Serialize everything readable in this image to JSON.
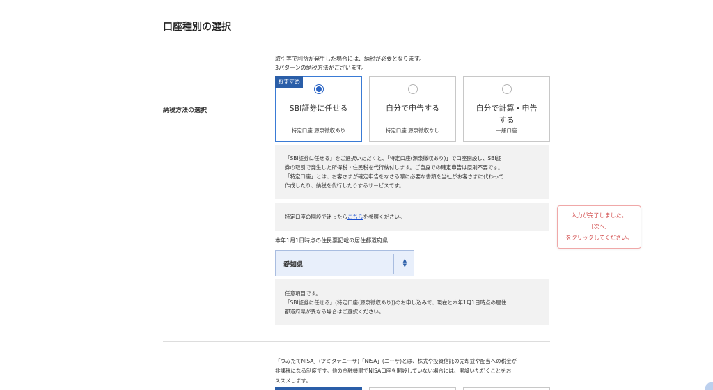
{
  "section": {
    "title": "口座種別の選択"
  },
  "intro": {
    "line1": "取引等で利益が発生した場合には、納税が必要となります。",
    "line2": "3パターンの納税方法がございます。"
  },
  "tax_method": {
    "label": "納税方法の選択",
    "options": [
      {
        "badge": "おすすめ",
        "title": "SBI証券に任せる",
        "sub": "特定口座 源泉徴収あり",
        "selected": true
      },
      {
        "title": "自分で申告する",
        "sub": "特定口座 源泉徴収なし",
        "selected": false
      },
      {
        "title": "自分で計算・申告する",
        "sub": "一般口座",
        "selected": false
      }
    ]
  },
  "explanation": {
    "line1": "「SBI証券に任せる」をご選択いただくと、「特定口座(源泉徴収あり)」で口座開設し、SBI証",
    "line2": "券の取引で発生した所得税・住民税を代行納付します。ご自身での確定申告は原則不要です。",
    "line3": "「特定口座」とは、お客さまが確定申告をなさる際に必要な書類を当社がお客さまに代わって",
    "line4": "作成したり、納税を代行したりするサービスです。"
  },
  "help": {
    "prefix": "特定口座の開設で迷ったら",
    "link": "こちら",
    "suffix": "を参照ください。"
  },
  "toast": {
    "line1": "入力が完了しました。",
    "line2": "［次へ］",
    "line3": "をクリックしてください。"
  },
  "prefecture": {
    "label": "本年1月1日時点の住民票記載の居住都道府県",
    "value": "愛知県"
  },
  "optional_note": {
    "line1": "任意項目です。",
    "line2": "「SBI証券に任せる」(特定口座(源泉徴収あり))のお申し込みで、現在と本年1月1日時点の居住",
    "line3": "都道府県が異なる場合はご選択ください。"
  },
  "nisa": {
    "line1": "「つみたてNISA」(ツミタテニーサ)「NISA」(ニーサ)とは、株式や投資信託の売却益や配当への税金が",
    "line2": "非課税になる制度です。他の金融機関でNISA口座を開設していない場合には、開設いただくことをお",
    "line3": "ススメします。"
  },
  "colors": {
    "accent": "#2a5ea8",
    "toast": "#d24a4a",
    "select_bg": "#e8effb"
  },
  "icons": {
    "select": "sort-arrows-icon"
  }
}
